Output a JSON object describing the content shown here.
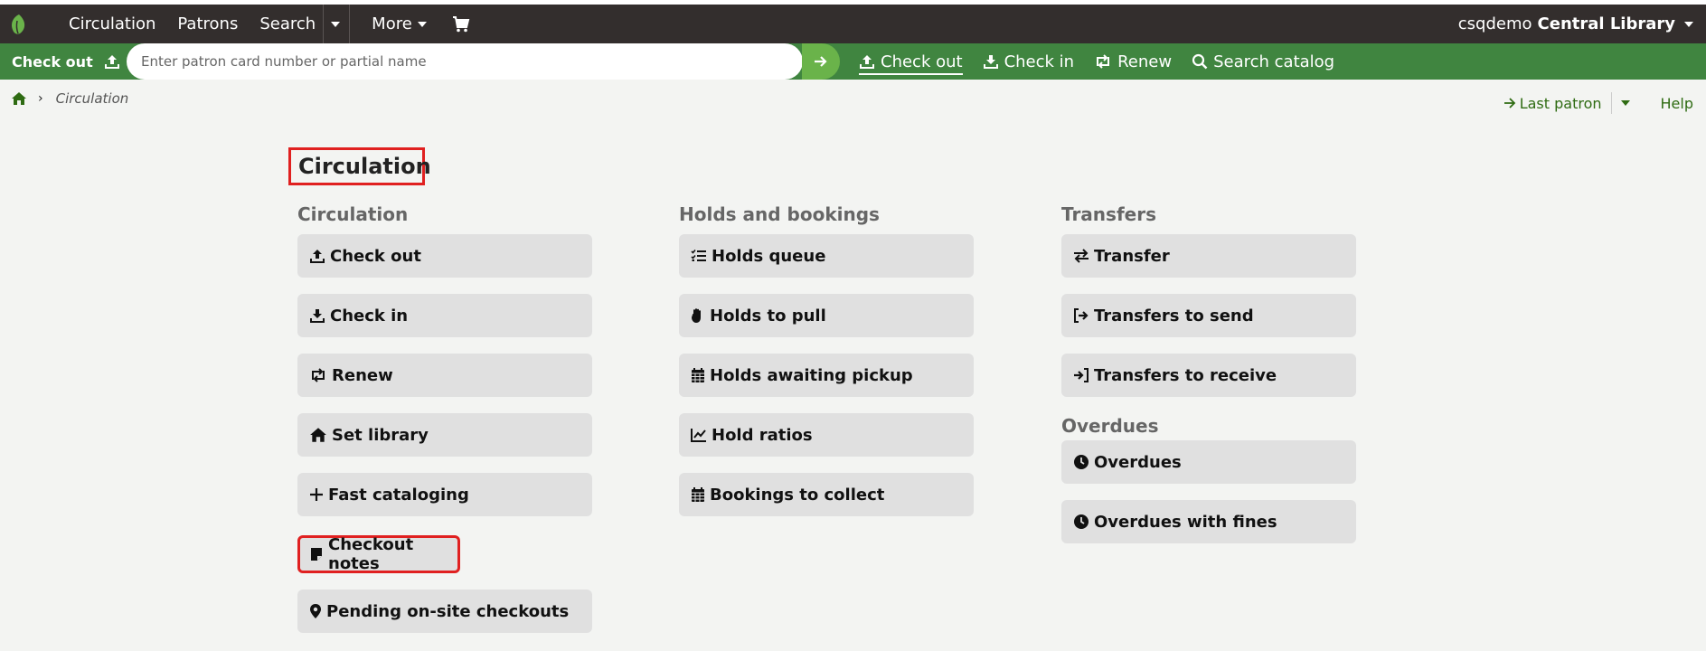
{
  "navbar": {
    "items": [
      {
        "label": "Circulation"
      },
      {
        "label": "Patrons"
      },
      {
        "label": "Search"
      },
      {
        "label": "More"
      }
    ],
    "user": "csqdemo",
    "library": "Central Library"
  },
  "greenbar": {
    "checkout_label": "Check out",
    "search_placeholder": "Enter patron card number or partial name",
    "quick_links": [
      {
        "label": "Check out",
        "icon": "upload-icon"
      },
      {
        "label": "Check in",
        "icon": "download-icon"
      },
      {
        "label": "Renew",
        "icon": "renew-icon"
      },
      {
        "label": "Search catalog",
        "icon": "search-icon"
      }
    ]
  },
  "breadcrumb": {
    "current": "Circulation"
  },
  "toolbar": {
    "last_patron": "Last patron",
    "help": "Help"
  },
  "page_title": "Circulation",
  "columns": {
    "circulation": {
      "heading": "Circulation",
      "buttons": [
        {
          "label": "Check out",
          "icon": "upload-icon"
        },
        {
          "label": "Check in",
          "icon": "download-icon"
        },
        {
          "label": "Renew",
          "icon": "renew-icon"
        },
        {
          "label": "Set library",
          "icon": "home-icon"
        },
        {
          "label": "Fast cataloging",
          "icon": "plus-icon"
        },
        {
          "label": "Checkout notes",
          "icon": "note-icon"
        },
        {
          "label": "Pending on-site checkouts",
          "icon": "map-pin-icon"
        }
      ]
    },
    "holds": {
      "heading": "Holds and bookings",
      "buttons": [
        {
          "label": "Holds queue",
          "icon": "list-check-icon"
        },
        {
          "label": "Holds to pull",
          "icon": "hand-icon"
        },
        {
          "label": "Holds awaiting pickup",
          "icon": "calendar-icon"
        },
        {
          "label": "Hold ratios",
          "icon": "line-chart-icon"
        },
        {
          "label": "Bookings to collect",
          "icon": "calendar-icon"
        }
      ]
    },
    "transfers": {
      "heading": "Transfers",
      "buttons": [
        {
          "label": "Transfer",
          "icon": "arrows-icon"
        },
        {
          "label": "Transfers to send",
          "icon": "sign-out-icon"
        },
        {
          "label": "Transfers to receive",
          "icon": "sign-in-icon"
        }
      ],
      "overdues_heading": "Overdues",
      "overdue_buttons": [
        {
          "label": "Overdues",
          "icon": "clock-icon"
        },
        {
          "label": "Overdues with fines",
          "icon": "clock-icon"
        }
      ]
    }
  },
  "colors": {
    "navbar": "#332e2d",
    "greenbar": "#408540",
    "go_button": "#6ab34a",
    "link": "#2e6b12",
    "highlight": "#e02020",
    "button_bg": "#e0e0e0"
  }
}
